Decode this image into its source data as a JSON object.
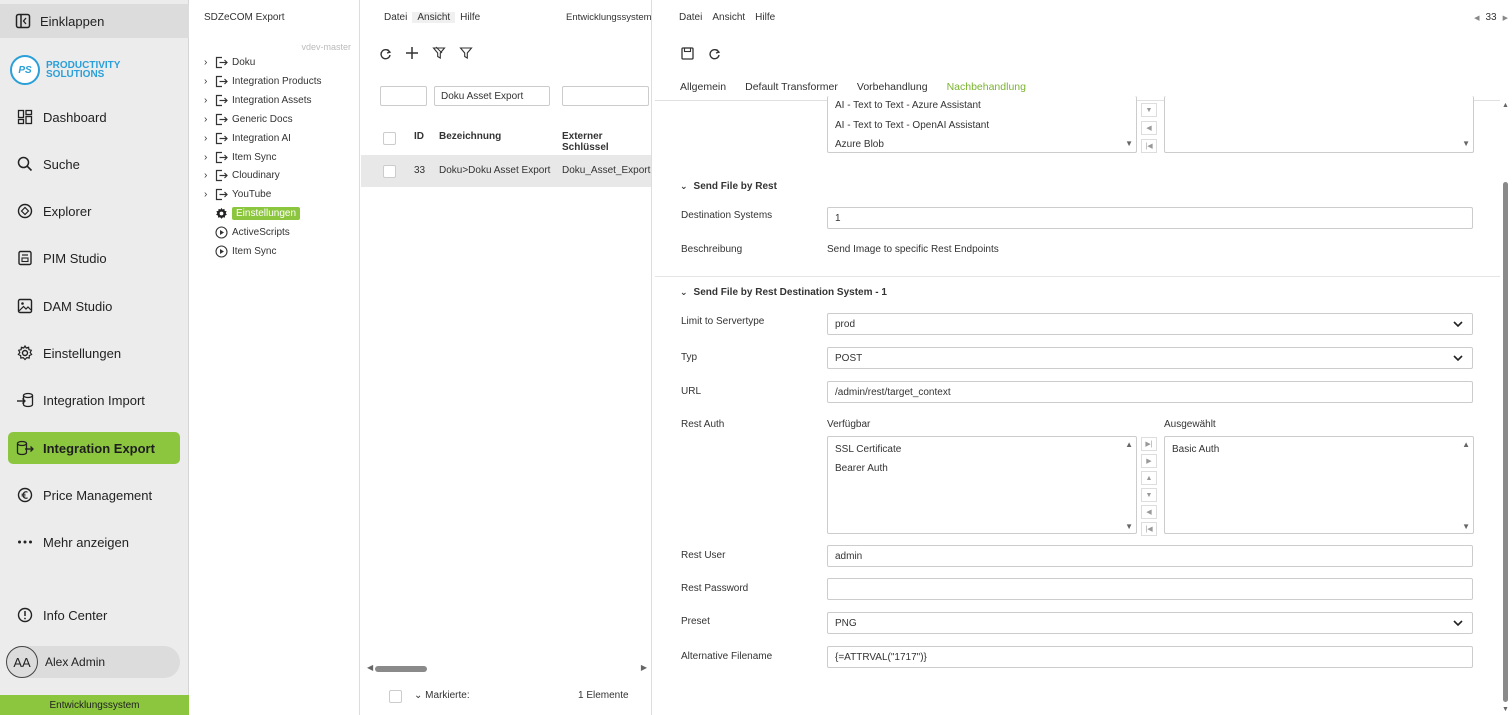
{
  "nav": {
    "collapse_label": "Einklappen",
    "logo_initials": "PS",
    "logo_line1": "PRODUCTIVITY",
    "logo_line2": "SOLUTIONS",
    "items": [
      {
        "label": "Dashboard",
        "icon": "dashboard-icon"
      },
      {
        "label": "Suche",
        "icon": "search-icon"
      },
      {
        "label": "Explorer",
        "icon": "explorer-icon"
      },
      {
        "label": "PIM Studio",
        "icon": "pim-studio-icon"
      },
      {
        "label": "DAM Studio",
        "icon": "image-icon"
      },
      {
        "label": "Einstellungen",
        "icon": "gear-icon"
      },
      {
        "label": "Integration Import",
        "icon": "import-icon"
      },
      {
        "label": "Integration Export",
        "icon": "export-icon",
        "active": true
      },
      {
        "label": "Price Management",
        "icon": "euro-icon"
      },
      {
        "label": "Mehr anzeigen",
        "icon": "more-icon"
      },
      {
        "label": "Info Center",
        "icon": "info-icon"
      }
    ],
    "user_initials": "AA",
    "user_name": "Alex Admin",
    "env_label": "Entwicklungssystem",
    "accent_color": "#8cc63f"
  },
  "tree": {
    "title": "SDZeCOM Export",
    "branch": "vdev-master",
    "items": [
      {
        "label": "Doku"
      },
      {
        "label": "Integration Products"
      },
      {
        "label": "Integration Assets"
      },
      {
        "label": "Generic Docs"
      },
      {
        "label": "Integration AI"
      },
      {
        "label": "Item Sync"
      },
      {
        "label": "Cloudinary"
      },
      {
        "label": "YouTube"
      },
      {
        "label": "Einstellungen",
        "selected": true
      },
      {
        "label": "ActiveScripts"
      },
      {
        "label": "Item Sync"
      }
    ]
  },
  "list": {
    "menu": [
      "Datei",
      "Ansicht",
      "Hilfe"
    ],
    "env_label": "Entwicklungssystem",
    "filter_name": "Doku Asset Export",
    "columns": {
      "id": "ID",
      "name": "Bezeichnung",
      "key": "Externer Schlüssel"
    },
    "rows": [
      {
        "id": "33",
        "name": "Doku>Doku Asset Export",
        "key": "Doku_Asset_Export"
      }
    ],
    "footer_marked": "Markierte:",
    "footer_count": "1 Elemente"
  },
  "detail": {
    "menu": [
      "Datei",
      "Ansicht",
      "Hilfe"
    ],
    "record_id": "33",
    "tabs": [
      "Allgemein",
      "Default Transformer",
      "Vorbehandlung",
      "Nachbehandlung"
    ],
    "active_tab": 3,
    "top_list": [
      "AI - Text to Text - Azure Assistant",
      "AI - Text to Text - OpenAI Assistant",
      "Azure Blob"
    ],
    "section1": {
      "title": "Send File by Rest",
      "dest_label": "Destination Systems",
      "dest_value": "1",
      "desc_label": "Beschreibung",
      "desc_value": "Send Image to specific Rest Endpoints"
    },
    "section2": {
      "title": "Send File by Rest Destination System - 1",
      "servertype_label": "Limit to Servertype",
      "servertype_value": "prod",
      "typ_label": "Typ",
      "typ_value": "POST",
      "url_label": "URL",
      "url_value": "/admin/rest/target_context",
      "auth_label": "Rest Auth",
      "available_label": "Verfügbar",
      "selected_label": "Ausgewählt",
      "available": [
        "SSL Certificate",
        "Bearer Auth"
      ],
      "selected": [
        "Basic Auth"
      ],
      "user_label": "Rest User",
      "user_value": "admin",
      "password_label": "Rest Password",
      "password_value": "",
      "preset_label": "Preset",
      "preset_value": "PNG",
      "altname_label": "Alternative Filename",
      "altname_value": "{=ATTRVAL(\"1717\")}"
    }
  }
}
